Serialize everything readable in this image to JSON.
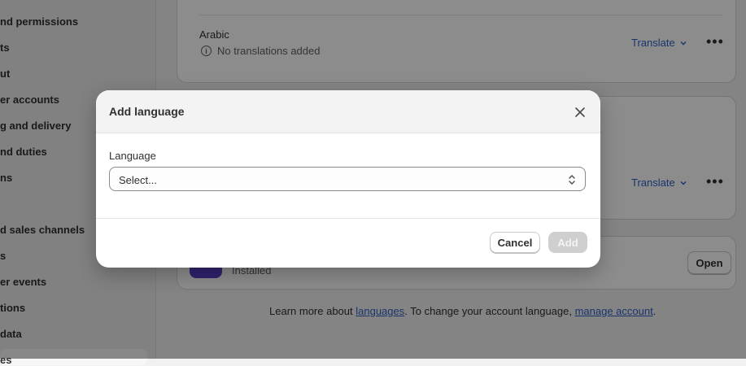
{
  "sidebar": {
    "items": [
      {
        "label": "nd permissions"
      },
      {
        "label": "ts"
      },
      {
        "label": "ut"
      },
      {
        "label": "er accounts"
      },
      {
        "label": "g and delivery"
      },
      {
        "label": "nd duties"
      },
      {
        "label": "ns"
      },
      {
        "label": "d sales channels"
      },
      {
        "label": "s"
      },
      {
        "label": "er events"
      },
      {
        "label": "tions"
      },
      {
        "label": "data"
      },
      {
        "label": "es"
      }
    ]
  },
  "languages": {
    "rows": [
      {
        "name": "Arabic",
        "status": "No translations added",
        "action": "Translate"
      }
    ],
    "second_translate": "Translate"
  },
  "app_card": {
    "status": "Installed",
    "open_label": "Open"
  },
  "footer": {
    "prefix": "Learn more about ",
    "link1": "languages",
    "middle": ". To change your account language, ",
    "link2": "manage account",
    "suffix": "."
  },
  "modal": {
    "title": "Add language",
    "field_label": "Language",
    "select_value": "Select...",
    "cancel_label": "Cancel",
    "add_label": "Add"
  },
  "colors": {
    "link": "#2f5fc6",
    "primary_disabled": "#cfcfcf"
  }
}
